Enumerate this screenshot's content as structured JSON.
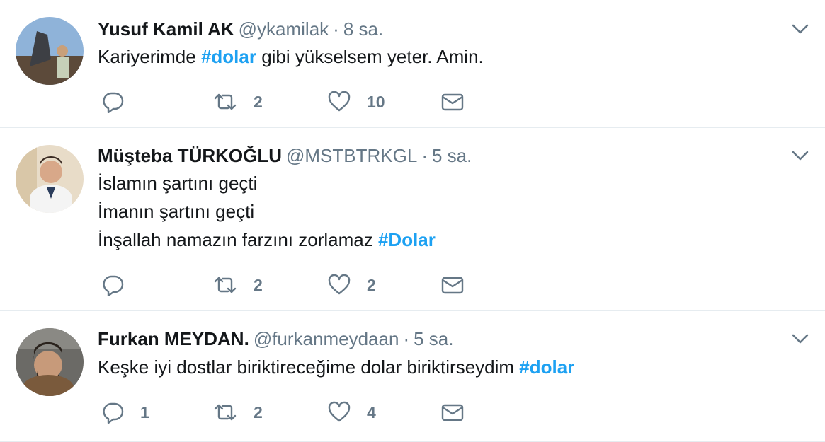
{
  "tweets": [
    {
      "name": "Yusuf Kamil AK",
      "handle": "@ykamilak",
      "dot": "·",
      "time": "8 sa.",
      "lines": [
        {
          "before": "Kariyerimde ",
          "hashtag": "#dolar",
          "after": " gibi yükselsem yeter. Amin."
        }
      ],
      "replies": "",
      "retweets": "2",
      "likes": "10"
    },
    {
      "name": "Müşteba TÜRKOĞLU",
      "handle": "@MSTBTRKGL",
      "dot": "·",
      "time": "5 sa.",
      "lines": [
        {
          "text": "İslamın şartını geçti"
        },
        {
          "text": "İmanın şartını geçti"
        },
        {
          "before": "İnşallah namazın farzını zorlamaz ",
          "hashtag": "#Dolar"
        }
      ],
      "replies": "",
      "retweets": "2",
      "likes": "2"
    },
    {
      "name": "Furkan MEYDAN.",
      "handle": "@furkanmeydaan",
      "dot": "·",
      "time": "5 sa.",
      "lines": [
        {
          "before": "Keşke iyi dostlar biriktireceğime dolar biriktirseydim ",
          "hashtag": "#dolar"
        }
      ],
      "replies": "1",
      "retweets": "2",
      "likes": "4"
    }
  ],
  "icons": {
    "reply": "reply-icon",
    "retweet": "retweet-icon",
    "like": "heart-icon",
    "dm": "envelope-icon",
    "menu": "chevron-down-icon"
  },
  "colors": {
    "hashtag": "#1da1f2",
    "secondary_text": "#657786",
    "divider": "#e6ecf0"
  }
}
